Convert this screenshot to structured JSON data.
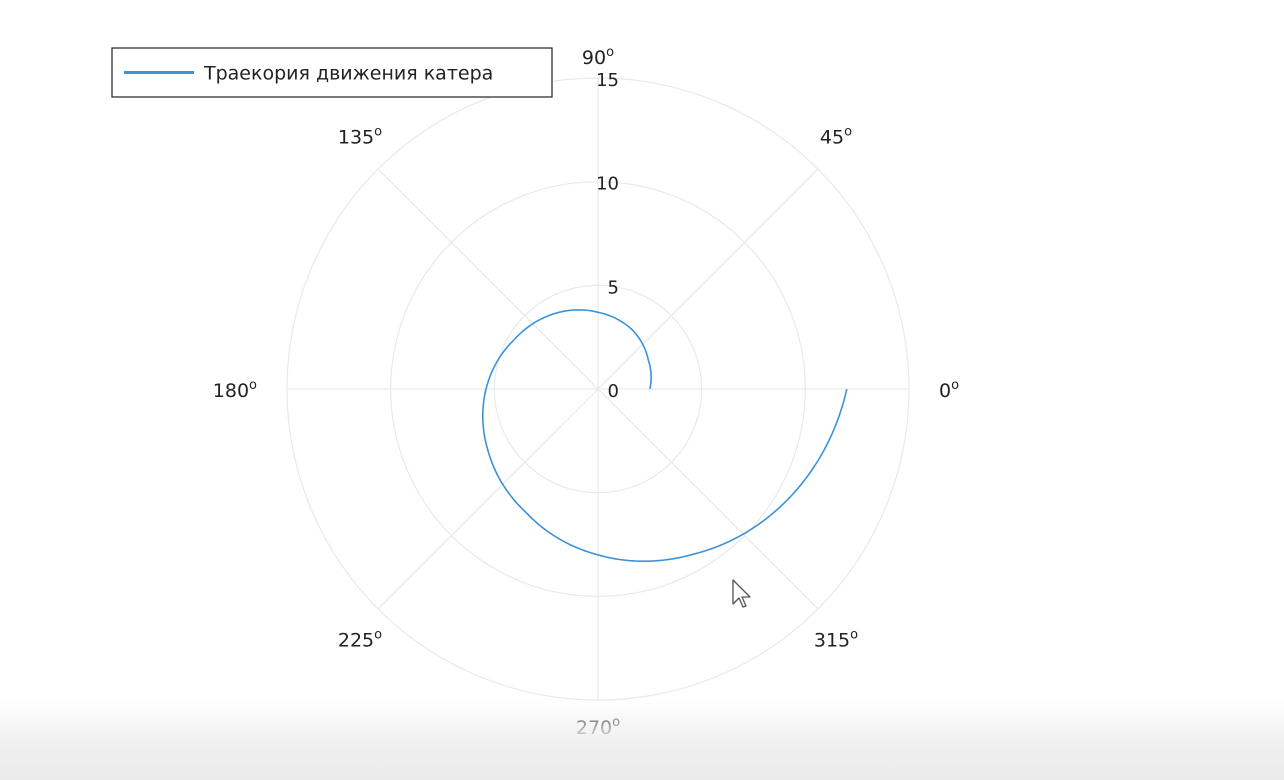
{
  "chart_data": {
    "type": "line",
    "coordinate_system": "polar",
    "title": "",
    "theta_unit": "degrees",
    "r_ticks": [
      "0",
      "5",
      "10",
      "15"
    ],
    "r_tick_values": [
      0,
      5,
      10,
      15
    ],
    "rlim": [
      0,
      15
    ],
    "theta_ticks": [
      {
        "deg": 0,
        "label": "0"
      },
      {
        "deg": 45,
        "label": "45"
      },
      {
        "deg": 90,
        "label": "90"
      },
      {
        "deg": 135,
        "label": "135"
      },
      {
        "deg": 180,
        "label": "180"
      },
      {
        "deg": 225,
        "label": "225"
      },
      {
        "deg": 270,
        "label": "270"
      },
      {
        "deg": 315,
        "label": "315"
      }
    ],
    "degree_symbol": "o",
    "grid": true,
    "legend": {
      "position": "top-left",
      "entries": [
        "Траекория движения катера"
      ]
    },
    "series": [
      {
        "name": "Траекория движения катера",
        "color": "#3b93d8",
        "theta_deg": [
          0,
          30,
          60,
          90,
          120,
          150,
          180,
          210,
          240,
          270,
          300,
          330,
          360
        ],
        "r": [
          2.5,
          2.8,
          3.3,
          3.7,
          4.2,
          4.7,
          5.4,
          6.1,
          6.9,
          8.0,
          9.2,
          10.6,
          12.0
        ]
      }
    ]
  },
  "colors": {
    "grid": "#e9e9e9",
    "axis_text": "#222222",
    "legend_border": "#333333",
    "series": "#3b93d8"
  },
  "cursor": {
    "icon": "mouse-pointer-icon"
  }
}
